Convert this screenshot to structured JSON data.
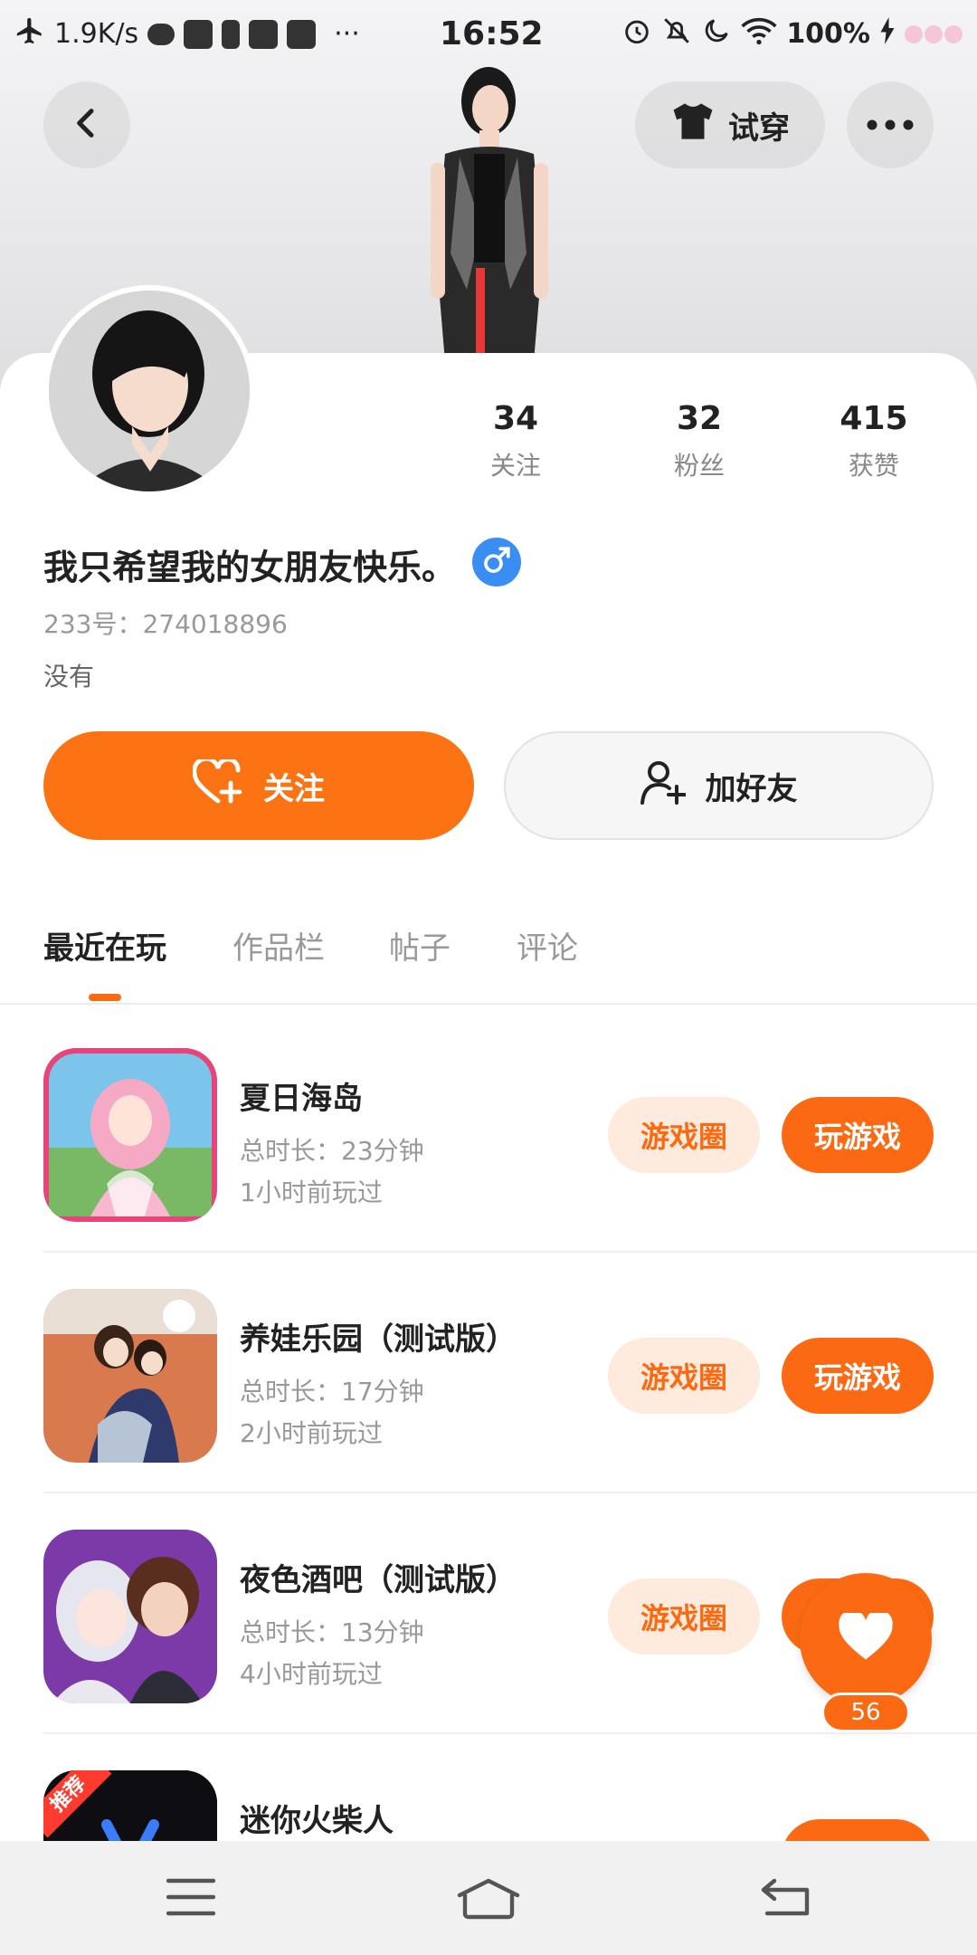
{
  "status_bar": {
    "network_speed": "1.9K/s",
    "time": "16:52",
    "battery": "100%",
    "more_dots": "···"
  },
  "header": {
    "try_on_label": "试穿"
  },
  "profile": {
    "stats": [
      {
        "value": "34",
        "label": "关注"
      },
      {
        "value": "32",
        "label": "粉丝"
      },
      {
        "value": "415",
        "label": "获赞"
      }
    ],
    "nickname": "我只希望我的女朋友快乐。",
    "uid": "233号：274018896",
    "bio": "没有",
    "follow_label": "关注",
    "add_friend_label": "加好友"
  },
  "tabs": [
    {
      "label": "最近在玩",
      "active": true
    },
    {
      "label": "作品栏",
      "active": false
    },
    {
      "label": "帖子",
      "active": false
    },
    {
      "label": "评论",
      "active": false
    }
  ],
  "games": [
    {
      "name": "夏日海岛",
      "duration": "总时长：23分钟",
      "last_played": "1小时前玩过",
      "circle_label": "游戏圈",
      "play_label": "玩游戏"
    },
    {
      "name": "养娃乐园（测试版）",
      "duration": "总时长：17分钟",
      "last_played": "2小时前玩过",
      "circle_label": "游戏圈",
      "play_label": "玩游戏"
    },
    {
      "name": "夜色酒吧（测试版）",
      "duration": "总时长：13分钟",
      "last_played": "4小时前玩过",
      "circle_label": "游戏圈",
      "play_label": "玩游戏"
    },
    {
      "name": "迷你火柴人",
      "badge": "推荐"
    }
  ],
  "floating_like": {
    "count": "56"
  },
  "colors": {
    "accent": "#fb6a13",
    "accent_light": "#ffebdd",
    "gender_male": "#3a8df2"
  },
  "icons": {
    "back": "chevron-left-icon",
    "try_on": "tshirt-icon",
    "more": "more-dots-icon",
    "gender": "male-symbol-icon",
    "follow": "heart-plus-icon",
    "add_friend": "person-plus-icon",
    "like": "heart-icon",
    "nav_menu": "menu-icon",
    "nav_home": "home-icon",
    "nav_back": "return-icon"
  }
}
